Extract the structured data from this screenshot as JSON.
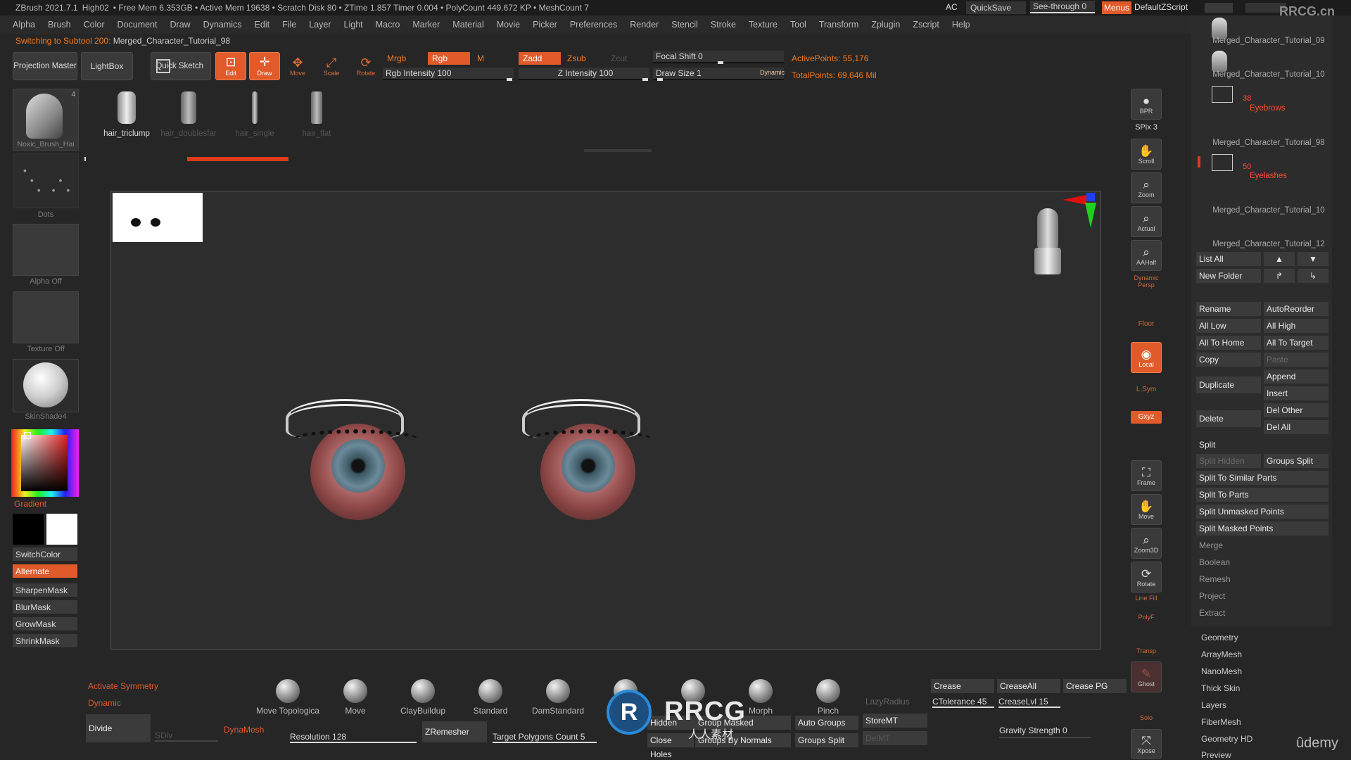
{
  "titlebar": {
    "app": "ZBrush 2021.7.1",
    "doc": "High02",
    "stats": "• Free Mem 6.353GB • Active Mem 19638 • Scratch Disk 80 • ZTime 1.857 Timer 0.004 • PolyCount 449.672 KP • MeshCount 7",
    "ac": "AC",
    "quicksave": "QuickSave",
    "seethrough": "See-through  0",
    "menus": "Menus",
    "script": "DefaultZScript",
    "watermark_site": "RRCG.cn"
  },
  "menubar": [
    "Alpha",
    "Brush",
    "Color",
    "Document",
    "Draw",
    "Dynamics",
    "Edit",
    "File",
    "Layer",
    "Light",
    "Macro",
    "Marker",
    "Material",
    "Movie",
    "Picker",
    "Preferences",
    "Render",
    "Stencil",
    "Stroke",
    "Texture",
    "Tool",
    "Transform",
    "Zplugin",
    "Zscript",
    "Help"
  ],
  "subtitle": {
    "prefix": "Switching to Subtool 200:",
    "name": "Merged_Character_Tutorial_98"
  },
  "toolbar": {
    "projection_master": "Projection Master",
    "lightbox": "LightBox",
    "quick_sketch": "Quick Sketch",
    "edit": "Edit",
    "draw": "Draw",
    "move": "Move",
    "scale": "Scale",
    "rotate": "Rotate",
    "mrgb": "Mrgb",
    "rgb": "Rgb",
    "m": "M",
    "zadd": "Zadd",
    "zsub": "Zsub",
    "zcut": "Zcut",
    "rgb_intensity": "Rgb Intensity 100",
    "z_intensity": "Z Intensity 100",
    "focal_shift": "Focal Shift 0",
    "draw_size": "Draw Size 1",
    "dynamic": "Dynamic",
    "active_points": "ActivePoints: 55,176",
    "total_points": "TotalPoints: 69.646 Mil"
  },
  "brush_strip": [
    "hair_triclump",
    "hair_doublesfar",
    "hair_single",
    "hair_flat"
  ],
  "left": {
    "brush_label": "Noxic_Brush_Hai",
    "brush_num": "4",
    "stroke_label": "Dots",
    "alpha_label": "Alpha Off",
    "texture_label": "Texture Off",
    "material_label": "SkinShade4",
    "gradient_label": "Gradient",
    "buttons": [
      "SwitchColor",
      "Alternate",
      "SharpenMask",
      "BlurMask",
      "GrowMask",
      "ShrinkMask"
    ]
  },
  "right_tools": {
    "bpr": "BPR",
    "spix": "SPix 3",
    "scroll": "Scroll",
    "zoom": "Zoom",
    "actual": "Actual",
    "aahalf": "AAHalf",
    "dynamic_persp": "Dynamic Persp",
    "floor": "Floor",
    "local": "Local",
    "lsym": "L.Sym",
    "xyz": "Gxyz",
    "frame": "Frame",
    "move": "Move",
    "zoom3d": "Zoom3D",
    "rotate": "Rotate",
    "linefill": "Line Fill",
    "polyf": "PolyF",
    "transp": "Transp",
    "ghost": "Ghost",
    "solo": "Solo",
    "xpose": "Xpose"
  },
  "subtools": {
    "items": [
      {
        "name": "Merged_Character_Tutorial_09"
      },
      {
        "name": "Merged_Character_Tutorial_10"
      },
      {
        "folder_count": "38",
        "folder_name": "Eyebrows"
      },
      {
        "name": "Merged_Character_Tutorial_98"
      },
      {
        "folder_count": "50",
        "folder_name": "Eyelashes"
      },
      {
        "name": "Merged_Character_Tutorial_10"
      },
      {
        "name": "Merged_Character_Tutorial_12"
      }
    ],
    "list_all": "List All",
    "new_folder": "New Folder",
    "rename": "Rename",
    "autoreorder": "AutoReorder",
    "all_low": "All Low",
    "all_high": "All High",
    "all_to_home": "All To Home",
    "all_to_target": "All To Target",
    "copy": "Copy",
    "paste": "Paste",
    "append": "Append",
    "duplicate": "Duplicate",
    "insert": "Insert",
    "del_other": "Del Other",
    "delete": "Delete",
    "del_all": "Del All",
    "split": "Split",
    "split_hidden": "Split Hidden",
    "groups_split": "Groups Split",
    "split_similar": "Split To Similar Parts",
    "split_parts": "Split To Parts",
    "split_unmasked": "Split Unmasked Points",
    "split_masked": "Split Masked Points",
    "menu": [
      "Merge",
      "Boolean",
      "Remesh",
      "Project",
      "Extract"
    ],
    "tool_menu": [
      "Geometry",
      "ArrayMesh",
      "NanoMesh",
      "Thick Skin",
      "Layers",
      "FiberMesh",
      "Geometry HD",
      "Preview"
    ]
  },
  "bottom": {
    "activate_symmetry": "Activate Symmetry",
    "dynamic": "Dynamic",
    "divide": "Divide",
    "sdiv": "SDiv",
    "dynamesh": "DynaMesh",
    "resolution": "Resolution 128",
    "zremesher": "ZRemesher",
    "target_polys": "Target Polygons Count 5",
    "brushes": [
      "Move Topologica",
      "Move",
      "ClayBuildup",
      "Standard",
      "DamStandard",
      "",
      "",
      "Morph",
      "Pinch"
    ],
    "lazyradius": "LazyRadius",
    "hidden": "Hidden",
    "group_masked": "Group Masked",
    "auto_groups": "Auto Groups",
    "storemt": "StoreMT",
    "close_holes": "Close Holes",
    "groups_by_normals": "Groups By Normals",
    "groups_split": "Groups Split",
    "delmt": "DelMT",
    "crease": "Crease",
    "creaseall": "CreaseAll",
    "crease_pg": "Crease PG",
    "ctolerance": "CTolerance 45",
    "creaselvl": "CreaseLvl 15",
    "gravity": "Gravity Strength 0",
    "udemy": "ûdemy",
    "logo_text": "RRCG",
    "logo_sub": "人人素材"
  }
}
